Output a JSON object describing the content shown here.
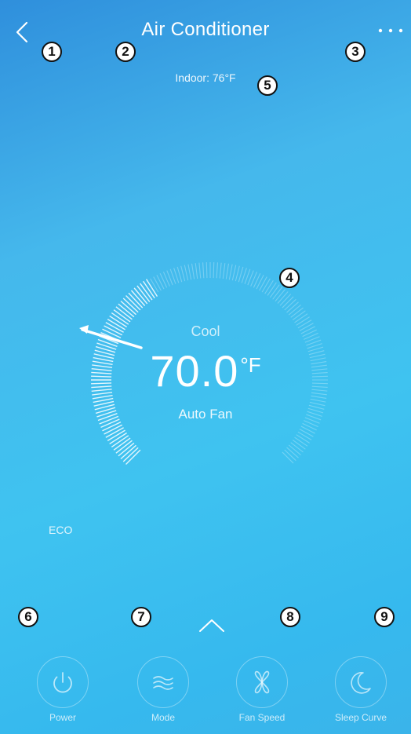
{
  "header": {
    "title": "Air Conditioner",
    "back_icon": "chevron-left-icon",
    "more_icon": "more-horizontal-icon"
  },
  "status": {
    "indoor": "Indoor: 76°F"
  },
  "dial": {
    "mode": "Cool",
    "temperature": "70.0",
    "unit": "°F",
    "fan": "Auto Fan"
  },
  "eco_label": "ECO",
  "expand_icon": "chevron-up-icon",
  "controls": [
    {
      "label": "Power",
      "icon": "power-icon"
    },
    {
      "label": "Mode",
      "icon": "waves-icon"
    },
    {
      "label": "Fan Speed",
      "icon": "fan-icon"
    },
    {
      "label": "Sleep Curve",
      "icon": "moon-icon"
    }
  ],
  "callouts": [
    "1",
    "2",
    "3",
    "4",
    "5",
    "6",
    "7",
    "8",
    "9"
  ],
  "colors": {
    "background_start": "#2f8fdc",
    "background_end": "#3fc3f0",
    "text": "#ffffff"
  }
}
